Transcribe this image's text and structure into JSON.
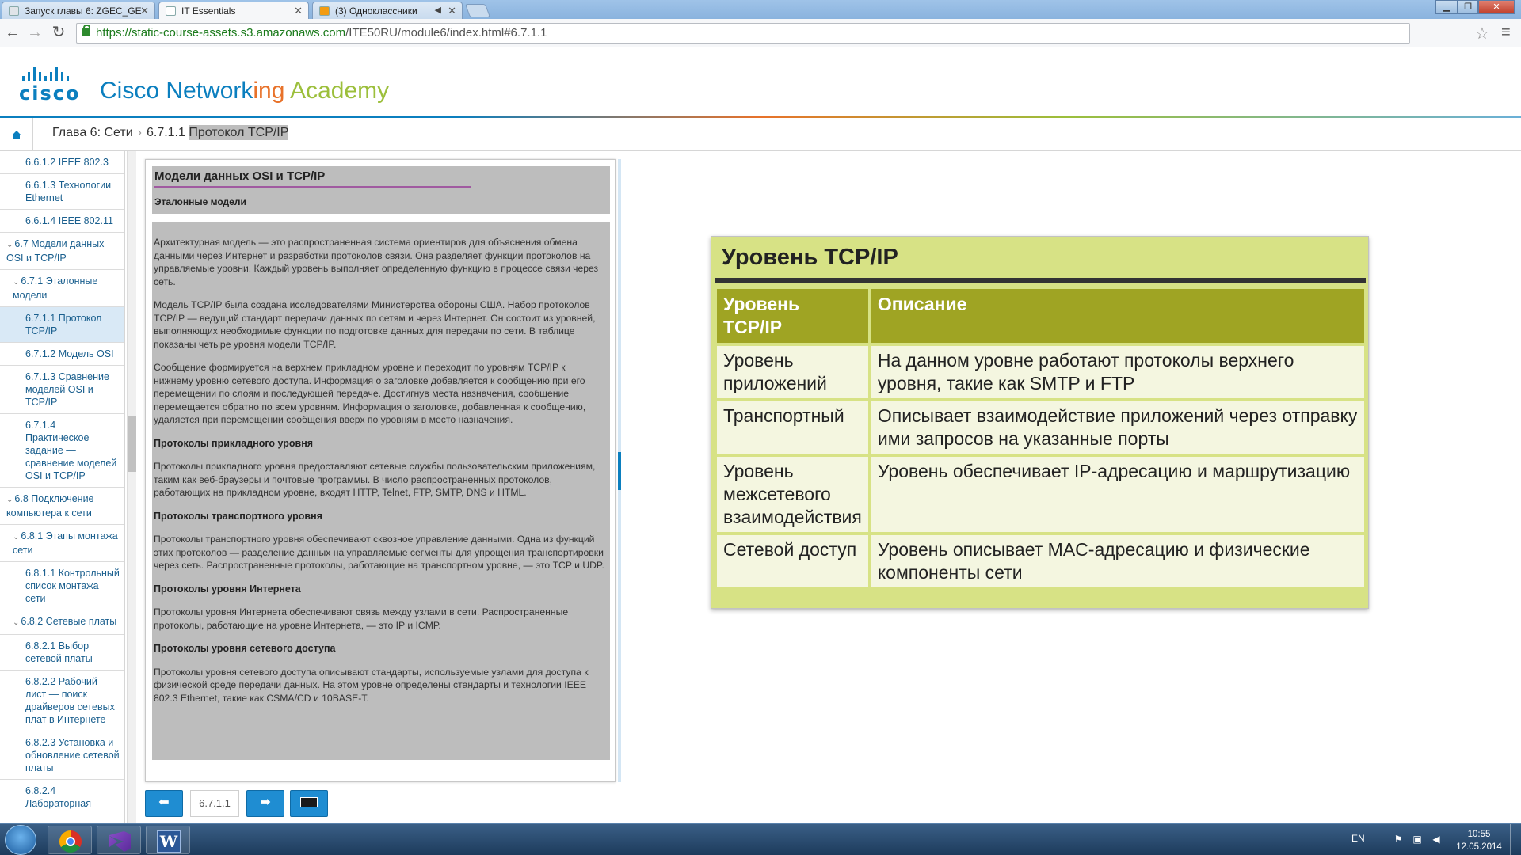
{
  "browser": {
    "tabs": [
      {
        "label": "Запуск главы 6: ZGEC_GE"
      },
      {
        "label": "IT Essentials"
      },
      {
        "label": "(3) Одноклассники"
      }
    ],
    "url_host": "https://static-course-assets.s3.amazonaws.com",
    "url_path": "/ITE50RU/module6/index.html#6.7.1.1"
  },
  "header": {
    "logo_word": "cisco",
    "brand_part1": "Cisco Network",
    "brand_part2": "ing",
    "brand_part3": " Academy"
  },
  "breadcrumb": {
    "chapter": "Глава 6: Сети",
    "section_num": "6.7.1.1",
    "section_title": "Протокол TCP/IP"
  },
  "sidebar": {
    "items": [
      {
        "label": "6.6.1.2 IEEE 802.3"
      },
      {
        "label": "6.6.1.3 Технологии Ethernet"
      },
      {
        "label": "6.6.1.4 IEEE 802.11"
      },
      {
        "label": "6.7 Модели данных OSI и TCP/IP"
      },
      {
        "label": "6.7.1 Эталонные модели"
      },
      {
        "label": "6.7.1.1 Протокол TCP/IP"
      },
      {
        "label": "6.7.1.2 Модель OSI"
      },
      {
        "label": "6.7.1.3 Сравнение моделей OSI и TCP/IP"
      },
      {
        "label": "6.7.1.4 Практическое задание — сравнение моделей OSI и TCP/IP"
      },
      {
        "label": "6.8 Подключение компьютера к сети"
      },
      {
        "label": "6.8.1 Этапы монтажа сети"
      },
      {
        "label": "6.8.1.1 Контрольный список монтажа сети"
      },
      {
        "label": "6.8.2 Сетевые платы"
      },
      {
        "label": "6.8.2.1 Выбор сетевой платы"
      },
      {
        "label": "6.8.2.2 Рабочий лист — поиск драйверов сетевых плат в Интернете"
      },
      {
        "label": "6.8.2.3 Установка и обновление сетевой платы"
      },
      {
        "label": "6.8.2.4 Лабораторная"
      }
    ]
  },
  "panel": {
    "title": "Модели данных OSI и TCP/IP",
    "subtitle": "Эталонные модели",
    "p1": "Архитектурная модель — это распространенная система ориентиров для объяснения обмена данными через Интернет и разработки протоколов связи. Она разделяет функции протоколов на управляемые уровни. Каждый уровень выполняет определенную функцию в процессе связи через сеть.",
    "p2": "Модель TCP/IP была создана исследователями Министерства обороны США. Набор протоколов TCP/IP — ведущий стандарт передачи данных по сетям и через Интернет. Он состоит из уровней, выполняющих необходимые функции по подготовке данных для передачи по сети. В таблице показаны четыре уровня модели TCP/IP.",
    "p3": "Сообщение формируется на верхнем прикладном уровне и переходит по уровням TCP/IP к нижнему уровню сетевого доступа. Информация о заголовке добавляется к сообщению при его перемещении по слоям и последующей передаче. Достигнув места назначения, сообщение перемещается обратно по всем уровням. Информация о заголовке, добавленная к сообщению, удаляется при перемещении сообщения вверх по уровням в место назначения.",
    "h_app": "Протоколы прикладного уровня",
    "p_app": "Протоколы прикладного уровня предоставляют сетевые службы пользовательским приложениям, таким как веб-браузеры и почтовые программы. В число распространенных протоколов, работающих на прикладном уровне, входят HTTP, Telnet, FTP, SMTP, DNS и HTML.",
    "h_tr": "Протоколы транспортного уровня",
    "p_tr": "Протоколы транспортного уровня обеспечивают сквозное управление данными. Одна из функций этих протоколов — разделение данных на управляемые сегменты для упрощения транспортировки через сеть. Распространенные протоколы, работающие на транспортном уровне, — это TCP и UDP.",
    "h_net": "Протоколы уровня Интернета",
    "p_net": "Протоколы уровня Интернета обеспечивают связь между узлами в сети. Распространенные протоколы, работающие на уровне Интернета, — это IP и ICMP.",
    "h_acc": "Протоколы уровня сетевого доступа",
    "p_acc": "Протоколы уровня сетевого доступа описывают стандарты, используемые узлами для доступа к физической среде передачи данных. На этом уровне определены стандарты и технологии IEEE 802.3 Ethernet, такие как CSMA/CD и 10BASE-T."
  },
  "nav": {
    "page": "6.7.1.1"
  },
  "card": {
    "title": "Уровень TCP/IP",
    "col1": "Уровень TCP/IP",
    "col2": "Описание",
    "rows": [
      {
        "layer": "Уровень приложений",
        "desc": "На данном уровне работают протоколы верхнего уровня, такие как SMTP и FTP"
      },
      {
        "layer": "Транспортный",
        "desc": "Описывает взаимодействие приложений через отправку ими запросов на указанные порты"
      },
      {
        "layer": "Уровень межсетевого взаимодействия",
        "desc": "Уровень обеспечивает IP-адресацию и маршрутизацию"
      },
      {
        "layer": "Сетевой доступ",
        "desc": "Уровень описывает MAC-адресацию и физические компоненты сети"
      }
    ],
    "colors": {
      "header_bg": "#9fa423",
      "card_bg": "#d7e285",
      "cell_bg": "#f4f6e0"
    }
  },
  "taskbar": {
    "lang": "EN",
    "time": "10:55",
    "date": "12.05.2014"
  }
}
